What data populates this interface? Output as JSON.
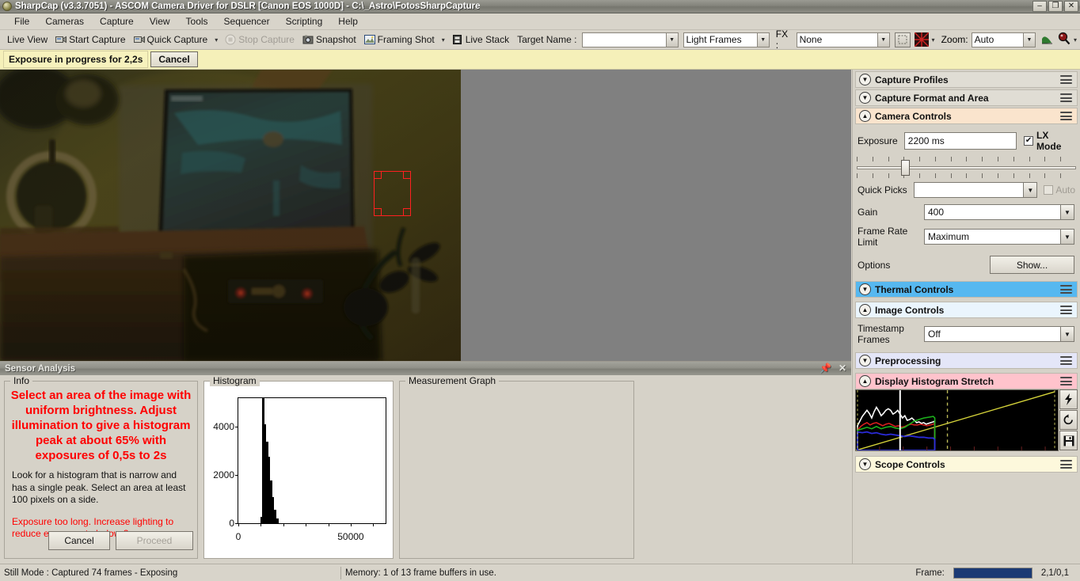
{
  "window": {
    "title": "SharpCap (v3.3.7051) - ASCOM Camera Driver for DSLR [Canon EOS 1000D] - C:\\_Astro\\FotosSharpCapture",
    "app_icon": "sharpcap-logo-icon",
    "minimize": "–",
    "restore": "❐",
    "close": "✕"
  },
  "menubar": {
    "items": [
      {
        "label": "File"
      },
      {
        "label": "Cameras"
      },
      {
        "label": "Capture"
      },
      {
        "label": "View"
      },
      {
        "label": "Tools"
      },
      {
        "label": "Sequencer"
      },
      {
        "label": "Scripting"
      },
      {
        "label": "Help"
      }
    ]
  },
  "toolbar": {
    "live_view": "Live View",
    "start_capture": "Start Capture",
    "quick_capture": "Quick Capture",
    "stop_capture": "Stop Capture",
    "snapshot": "Snapshot",
    "framing_shot": "Framing Shot",
    "live_stack": "Live Stack",
    "target_name_label": "Target Name :",
    "target_name_value": "",
    "frame_type": "Light Frames",
    "fx_label": "FX :",
    "fx_value": "None",
    "zoom_label": "Zoom:",
    "zoom_value": "Auto",
    "caret": "▾"
  },
  "notice": {
    "text": "Exposure in progress for 2,2s",
    "cancel": "Cancel"
  },
  "right_panel": {
    "sections": [
      {
        "name": "Capture Profiles",
        "expanded": false,
        "color": "#e0ddd4",
        "chevron": "▼"
      },
      {
        "name": "Capture Format and Area",
        "expanded": false,
        "color": "#e0ddd4",
        "chevron": "▼"
      },
      {
        "name": "Camera Controls",
        "expanded": true,
        "color": "#fae4cd",
        "chevron": "▲"
      },
      {
        "name": "Thermal Controls",
        "expanded": false,
        "color": "#56b8f0",
        "chevron": "▼"
      },
      {
        "name": "Image Controls",
        "expanded": true,
        "color": "#eaf5fd",
        "chevron": "▲"
      },
      {
        "name": "Preprocessing",
        "expanded": false,
        "color": "#e4e6f8",
        "chevron": "▼"
      },
      {
        "name": "Display Histogram Stretch",
        "expanded": true,
        "color": "#ffc3cc",
        "chevron": "▲"
      },
      {
        "name": "Scope Controls",
        "expanded": false,
        "color": "#fdf8dc",
        "chevron": "▼"
      }
    ],
    "camera_controls": {
      "exposure_label": "Exposure",
      "exposure_value": "2200 ms",
      "lx_mode_label": "LX Mode",
      "lx_mode_checked": true,
      "lx_mode_check_glyph": "✔",
      "exposure_slider_percent": 22,
      "quick_picks_label": "Quick Picks",
      "quick_picks_value": "",
      "auto_label": "Auto",
      "auto_checked": false,
      "gain_label": "Gain",
      "gain_value": "400",
      "frame_rate_limit_label": "Frame Rate Limit",
      "frame_rate_limit_value": "Maximum",
      "options_label": "Options",
      "options_button": "Show..."
    },
    "image_controls": {
      "timestamp_label": "Timestamp Frames",
      "timestamp_value": "Off"
    },
    "histogram_stretch": {
      "auto_stretch_icon": "lightning-icon",
      "reset_icon": "reset-circular-arrow-icon",
      "save_icon": "floppy-disk-save-icon",
      "left_marker_percent": 0.8,
      "mid_marker_percent": 16,
      "right_marker_percent": 46,
      "far_right_marker_percent": 99,
      "line_color": "#d6d43a"
    }
  },
  "sensor_analysis": {
    "panel_title": "Sensor Analysis",
    "pin_icon": "pin-icon",
    "close_icon": "close-icon",
    "info_group_label": "Info",
    "info_headline": "Select an area of the image with uniform brightness. Adjust illumination to give a histogram peak at about 65% with exposures of 0,5s to 2s",
    "info_body": "Look for a histogram that is narrow and has a single peak. Select an area at least 100 pixels on a side.",
    "info_warning": "Exposure too long. Increase lighting to reduce exposure to below 2s",
    "cancel_button": "Cancel",
    "proceed_button": "Proceed",
    "histogram_group_label": "Histogram",
    "measurement_group_label": "Measurement Graph"
  },
  "chart_data": {
    "type": "bar",
    "title": "Histogram",
    "xlabel": "",
    "ylabel": "",
    "xlim": [
      0,
      65535
    ],
    "ylim": [
      0,
      5200
    ],
    "x_ticks": [
      0,
      50000
    ],
    "x_tick_labels": [
      "0",
      "50000"
    ],
    "y_ticks": [
      0,
      2000,
      4000
    ],
    "y_tick_labels": [
      "0",
      "2000",
      "4000"
    ],
    "grid": false,
    "legend": "none",
    "bin_width": 900,
    "bins": [
      {
        "x": 9700,
        "value": 250
      },
      {
        "x": 10600,
        "value": 5200
      },
      {
        "x": 11500,
        "value": 4100
      },
      {
        "x": 12400,
        "value": 3400
      },
      {
        "x": 13300,
        "value": 2750
      },
      {
        "x": 14200,
        "value": 1780
      },
      {
        "x": 15100,
        "value": 1080
      },
      {
        "x": 16000,
        "value": 560
      },
      {
        "x": 16900,
        "value": 190
      }
    ]
  },
  "statusbar": {
    "mode": "Still Mode : Captured 74 frames - Exposing",
    "memory": "Memory: 1 of 13 frame buffers in use.",
    "frame_label": "Frame:",
    "frame_progress_percent": 100,
    "frame_counts": "2,1/0,1"
  }
}
